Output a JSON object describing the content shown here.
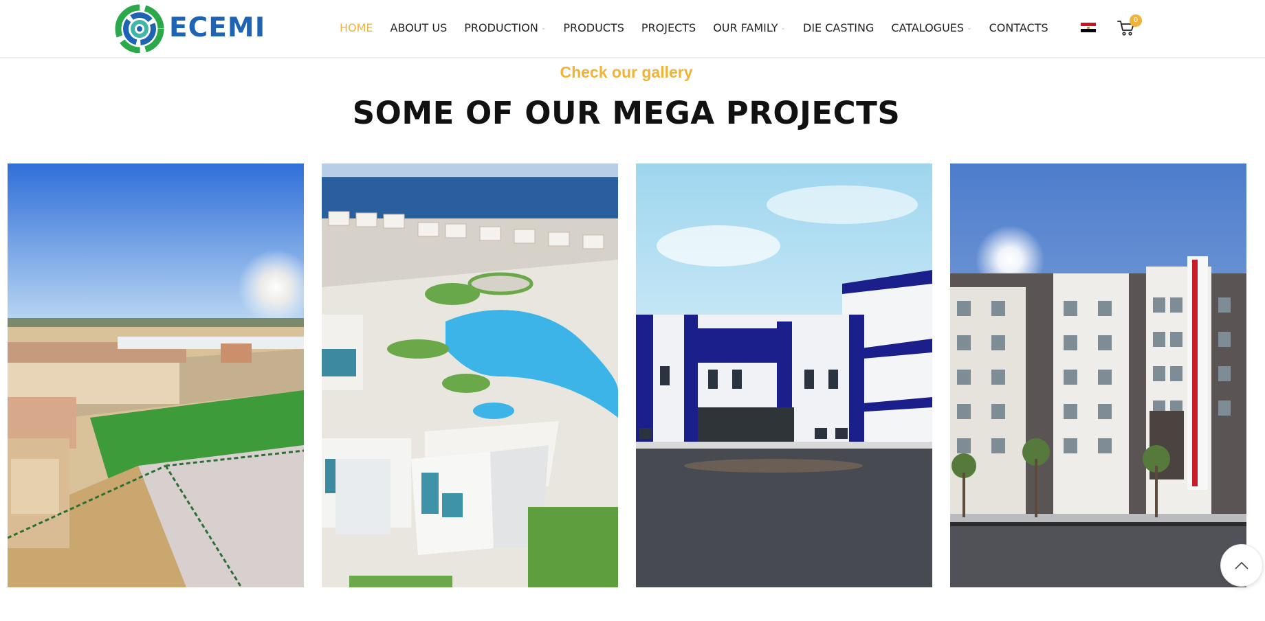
{
  "brand": {
    "name": "ECEMI",
    "logo_icon": "ecemi-logo-icon",
    "color": "#1f64b4"
  },
  "nav": {
    "items": [
      {
        "label": "HOME",
        "active": true,
        "dropdown": false
      },
      {
        "label": "ABOUT US",
        "active": false,
        "dropdown": false
      },
      {
        "label": "PRODUCTION",
        "active": false,
        "dropdown": true
      },
      {
        "label": "PRODUCTS",
        "active": false,
        "dropdown": false
      },
      {
        "label": "PROJECTS",
        "active": false,
        "dropdown": false
      },
      {
        "label": "OUR FAMILY",
        "active": false,
        "dropdown": true
      },
      {
        "label": "DIE CASTING",
        "active": false,
        "dropdown": false
      },
      {
        "label": "CATALOGUES",
        "active": false,
        "dropdown": true
      },
      {
        "label": "CONTACTS",
        "active": false,
        "dropdown": false
      }
    ],
    "active_color": "#f0b33a"
  },
  "header_actions": {
    "language_icon": "egypt-flag-icon",
    "cart_icon": "cart-icon",
    "cart_count": "0"
  },
  "section": {
    "eyebrow": "Check our gallery",
    "title": "SOME OF OUR MEGA PROJECTS",
    "accent_color": "#f0b33a"
  },
  "gallery": {
    "tiles": [
      {
        "icon": "project-photo-industrial-complex"
      },
      {
        "icon": "project-photo-coastal-resort"
      },
      {
        "icon": "project-photo-school-building"
      },
      {
        "icon": "project-photo-residential-apartments"
      }
    ]
  },
  "scroll_top": {
    "icon": "chevron-up-icon"
  }
}
